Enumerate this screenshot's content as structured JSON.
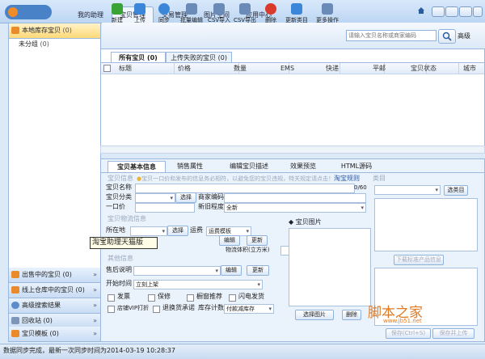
{
  "nav": {
    "tabs": [
      "我的助理",
      "宝贝管理",
      "交易管理",
      "图片空间",
      "应用中心"
    ]
  },
  "left": {
    "root": "本地库存宝贝",
    "root_count": "(0)",
    "child": "未分组",
    "child_count": "(0)",
    "bottom": [
      {
        "label": "出售中的宝贝",
        "count": "(0)"
      },
      {
        "label": "线上仓库中的宝贝",
        "count": "(0)"
      },
      {
        "label": "高级搜索结果",
        "count": ""
      },
      {
        "label": "回收站",
        "count": "(0)"
      },
      {
        "label": "宝贝模板",
        "count": "(0)"
      }
    ],
    "chevron": "»"
  },
  "toolbar": {
    "buttons": [
      {
        "label": "新建",
        "icon": "plus-icon",
        "color": "#3aa335"
      },
      {
        "label": "上传",
        "icon": "upload-icon",
        "color": "#3b86d8"
      },
      {
        "label": "同步",
        "icon": "sync-icon",
        "color": "#3b86d8"
      },
      {
        "label": "批量编辑",
        "icon": "edit-icon",
        "color": "#6a8ab8"
      },
      {
        "label": "CSV导入",
        "icon": "csv-import-icon",
        "color": "#6a8ab8"
      },
      {
        "label": "CSV导出",
        "icon": "csv-export-icon",
        "color": "#6a8ab8"
      },
      {
        "label": "删除",
        "icon": "delete-icon",
        "color": "#d93a2b"
      },
      {
        "label": "更新类目",
        "icon": "download-icon",
        "color": "#3b86d8"
      },
      {
        "label": "更多操作",
        "icon": "more-icon",
        "color": "#6a8ab8"
      }
    ],
    "search_placeholder": "请输入宝贝名称或商家编码",
    "search_link": "高级"
  },
  "list": {
    "tabs": [
      "所有宝贝 (0)",
      "上传失败的宝贝 (0)"
    ],
    "columns": [
      "标题",
      "价格",
      "数量",
      "EMS",
      "快递",
      "平邮",
      "宝贝状态",
      "城市"
    ]
  },
  "detail": {
    "tabs": [
      "宝贝基本信息",
      "销售属性",
      "编辑宝贝描述",
      "效果预览",
      "HTML源码"
    ],
    "section_info": "宝贝信息",
    "notice": "宝贝一口价和发布的信息务必相符，以避免您的宝贝违规，特关规定请点击！",
    "notice_link": "淘宝规则",
    "label_name": "宝贝名称",
    "name_counter": "0/60",
    "label_category": "宝贝分类",
    "btn_select": "选择",
    "label_merchant_code": "商家编码",
    "label_price": "一口价",
    "label_condition": "新旧程度",
    "condition_value": "全新",
    "section_logistics": "宝贝物流信息",
    "label_location": "所在地",
    "btn_select2": "选择",
    "label_shipping": "运费",
    "shipping_value": "运费模板",
    "btn_edit": "编辑",
    "btn_update": "更新",
    "label_volume": "物流体积(立方米)",
    "section_other": "其他信息",
    "label_aftersale": "售后说明",
    "btn_edit2": "编辑",
    "btn_update2": "更新",
    "label_start": "开始时间",
    "start_value": "立刻上架",
    "chk_invoice": "发票",
    "chk_warranty": "保修",
    "chk_recommend": "橱窗推荐",
    "chk_flash": "闪电发货",
    "chk_vip": "店铺VIP打折",
    "chk_return": "退换货承诺",
    "label_stock": "库存计数",
    "stock_value": "付款减库存",
    "section_images": "宝贝图片",
    "btn_select_image": "选择图片",
    "btn_delete_image": "删除",
    "section_category": "类目",
    "btn_select_category": "选类目",
    "btn_standard_info": "下载标准产品信息",
    "btn_save": "保存(Ctrl+S)",
    "btn_save_upload": "保存并上传"
  },
  "tooltip": "淘宝助理天猫版",
  "status": "数据同步完成，最新一次同步时间为2014-03-19 10:28:37",
  "watermark": "脚本之家",
  "watermark_url": "www.jb51.net"
}
